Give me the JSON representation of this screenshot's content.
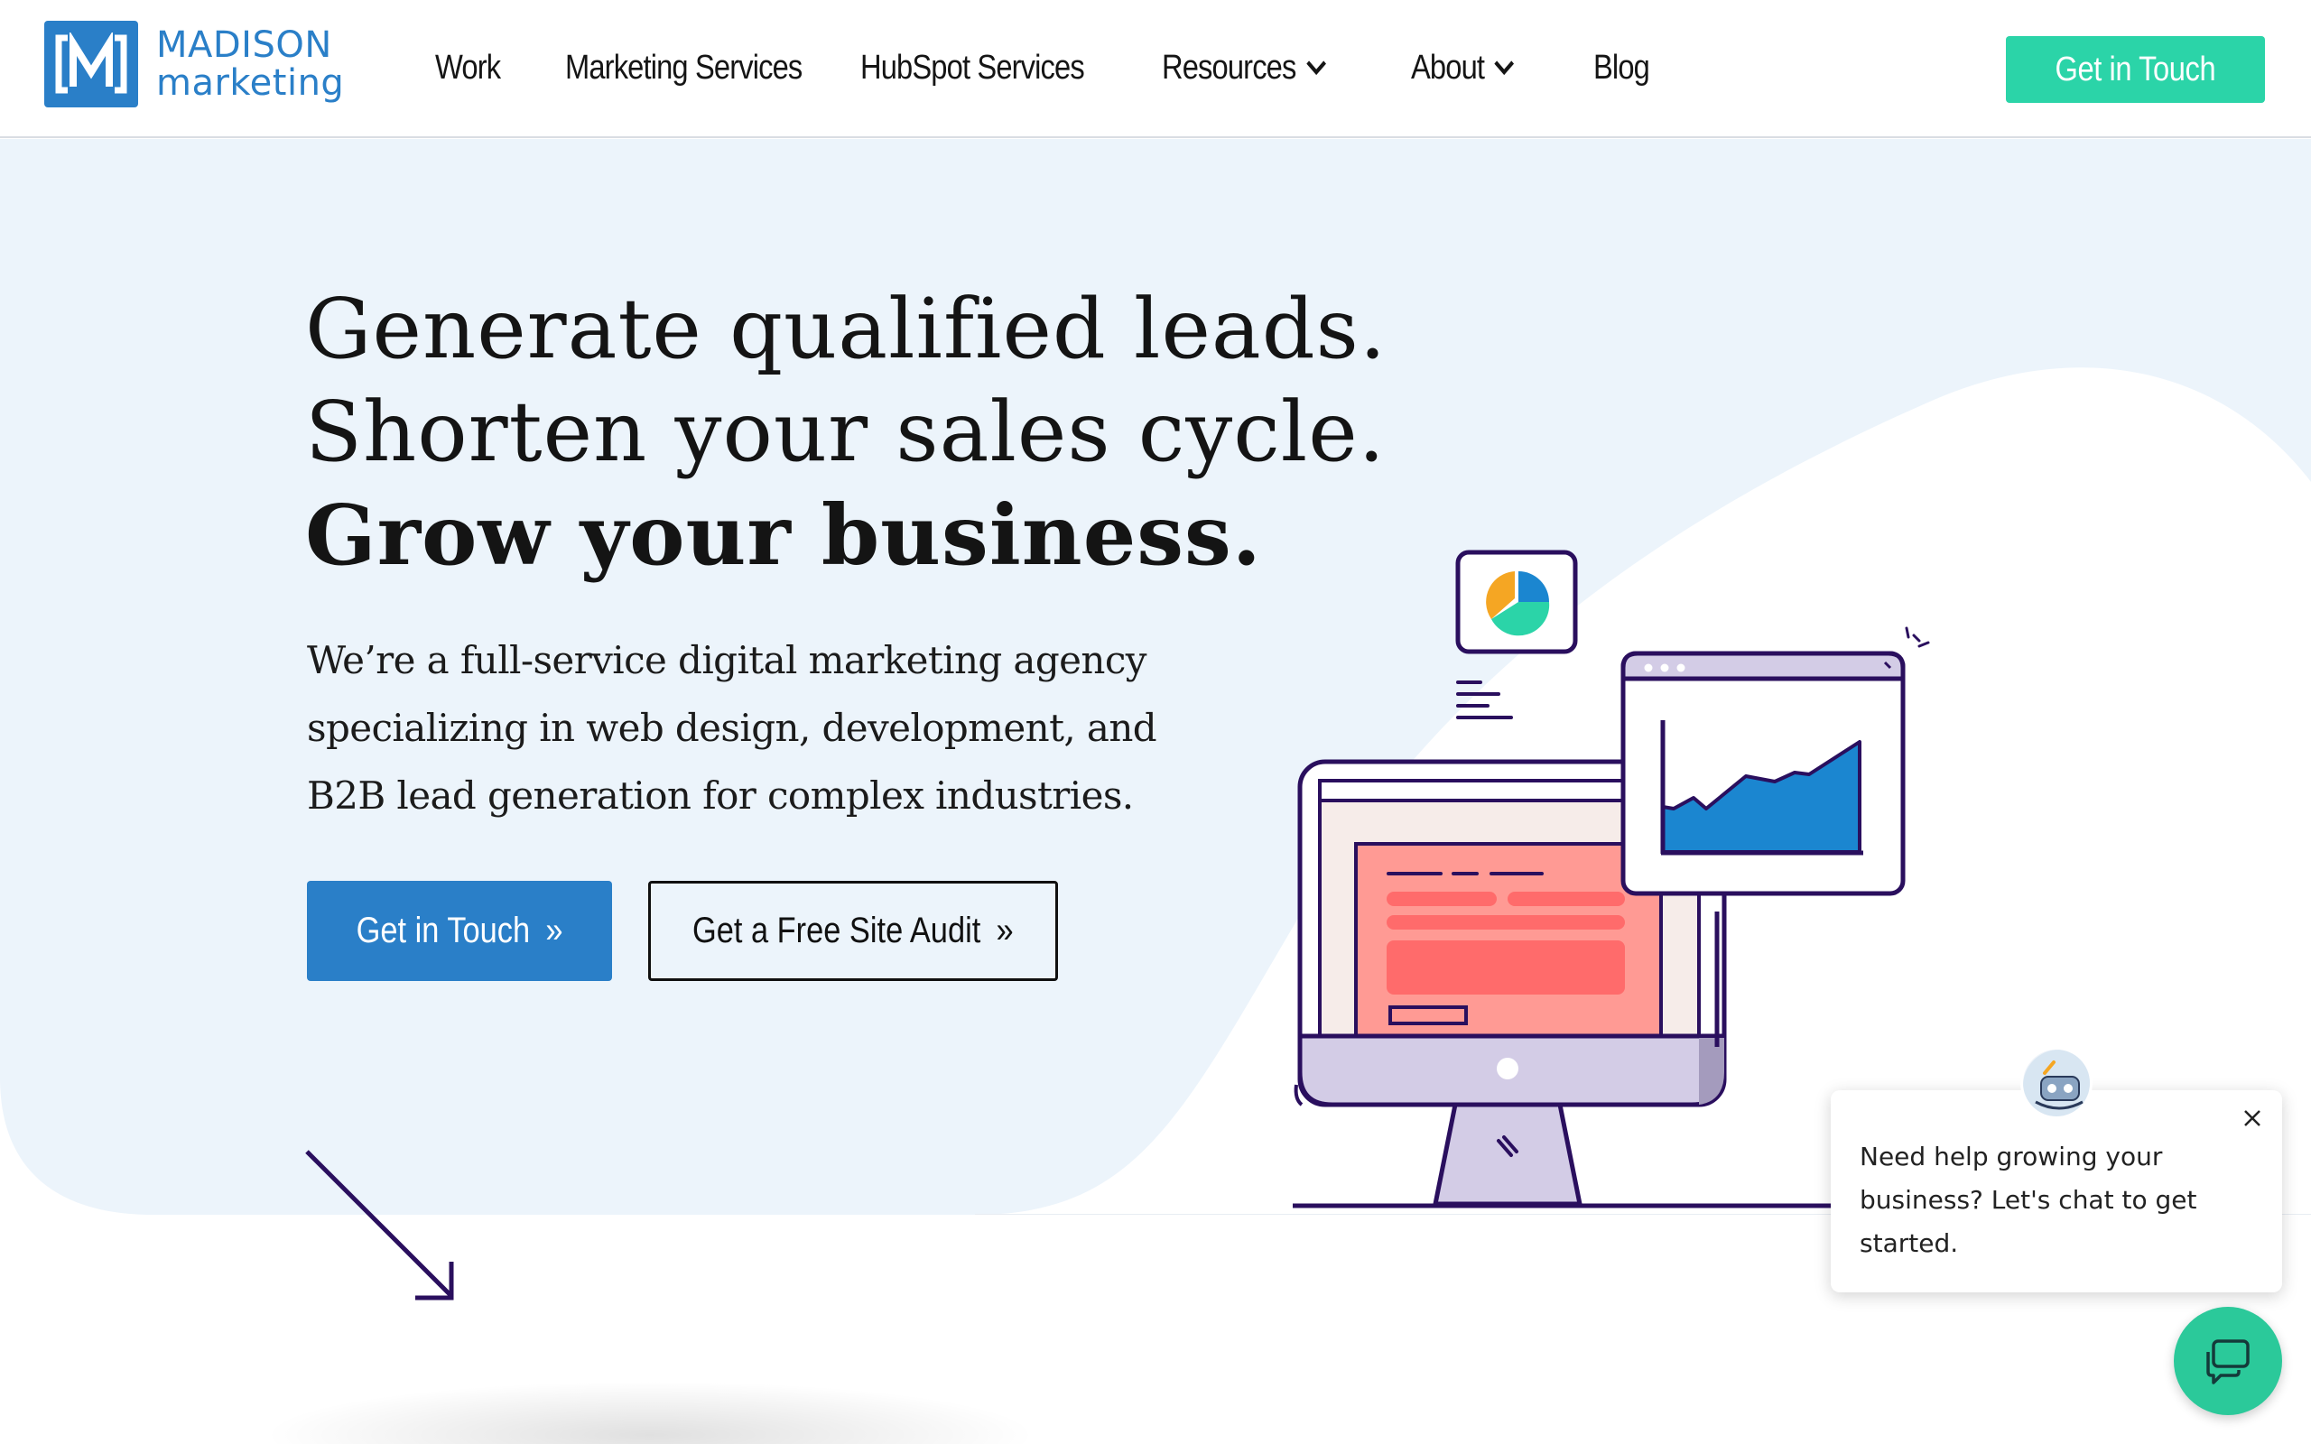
{
  "brand": {
    "name_line1": "MADISON",
    "name_line2": "marketing",
    "color": "#2a7fc8"
  },
  "nav": {
    "items": [
      {
        "label": "Work",
        "dropdown": false
      },
      {
        "label": "Marketing Services",
        "dropdown": true
      },
      {
        "label": "HubSpot Services",
        "dropdown": true
      },
      {
        "label": "Resources",
        "dropdown": true
      },
      {
        "label": "About",
        "dropdown": true
      },
      {
        "label": "Blog",
        "dropdown": false
      }
    ],
    "cta_label": "Get in Touch"
  },
  "hero": {
    "headline_line1": "Generate qualified leads.",
    "headline_line2": "Shorten your sales cycle.",
    "headline_line3": "Grow your business.",
    "subtext": "We’re a full-service digital marketing agency specializing in web design, development, and B2B lead generation for complex industries.",
    "primary_button": "Get in Touch",
    "secondary_button": "Get a Free Site Audit",
    "button_arrow": "»"
  },
  "chat": {
    "message": "Need help growing your business? Let's chat to get started.",
    "close_icon": "close-icon",
    "launcher_icon": "chat-bubbles-icon"
  },
  "colors": {
    "accent_green": "#2bd4a8",
    "primary_blue": "#2a7fc8",
    "hero_bg": "#ecf4fb",
    "illustration_ink": "#2a0f5e",
    "coral": "#ff6b6b",
    "chat_green": "#2bc99a"
  }
}
